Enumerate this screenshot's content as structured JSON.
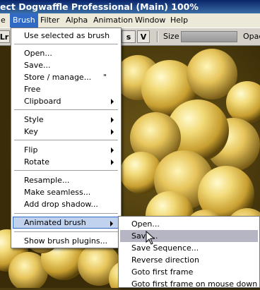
{
  "title": "ect Dogwaffle Professional  (Main)  100%",
  "menubar": {
    "items": [
      {
        "label": "e"
      },
      {
        "label": "Brush"
      },
      {
        "label": "Filter"
      },
      {
        "label": "Alpha"
      },
      {
        "label": "Animation"
      },
      {
        "label": "Window"
      },
      {
        "label": "Help"
      }
    ]
  },
  "toolbar": {
    "left_btn": "Lr",
    "right_btn_s": "s",
    "v_btn": "V",
    "size_label": "Size",
    "opac_label": "Opac"
  },
  "brush_menu": {
    "items": [
      {
        "label": "Use selected as brush"
      },
      {
        "label": "Open..."
      },
      {
        "label": "Save..."
      },
      {
        "label": "Store / manage...",
        "shortcut": "\""
      },
      {
        "label": "Free"
      },
      {
        "label": "Clipboard"
      },
      {
        "label": "Style"
      },
      {
        "label": "Key"
      },
      {
        "label": "Flip"
      },
      {
        "label": "Rotate"
      },
      {
        "label": "Resample..."
      },
      {
        "label": "Make seamless..."
      },
      {
        "label": "Add drop shadow..."
      },
      {
        "label": "Animated brush"
      },
      {
        "label": "Show brush plugins..."
      }
    ]
  },
  "animated_submenu": {
    "items": [
      {
        "label": "Open..."
      },
      {
        "label": "Save..."
      },
      {
        "label": "Save Sequence..."
      },
      {
        "label": "Reverse direction"
      },
      {
        "label": "Goto first frame"
      },
      {
        "label": "Goto first frame on mouse down"
      }
    ]
  },
  "colors": {
    "menu_highlight": "#c1d2ee",
    "menu_highlight_border": "#316ac5",
    "submenu_highlight": "#b6b5c4",
    "sphere_light": "#fff2a8",
    "sphere_mid": "#e0c050",
    "sphere_dark": "#7a5e10"
  }
}
